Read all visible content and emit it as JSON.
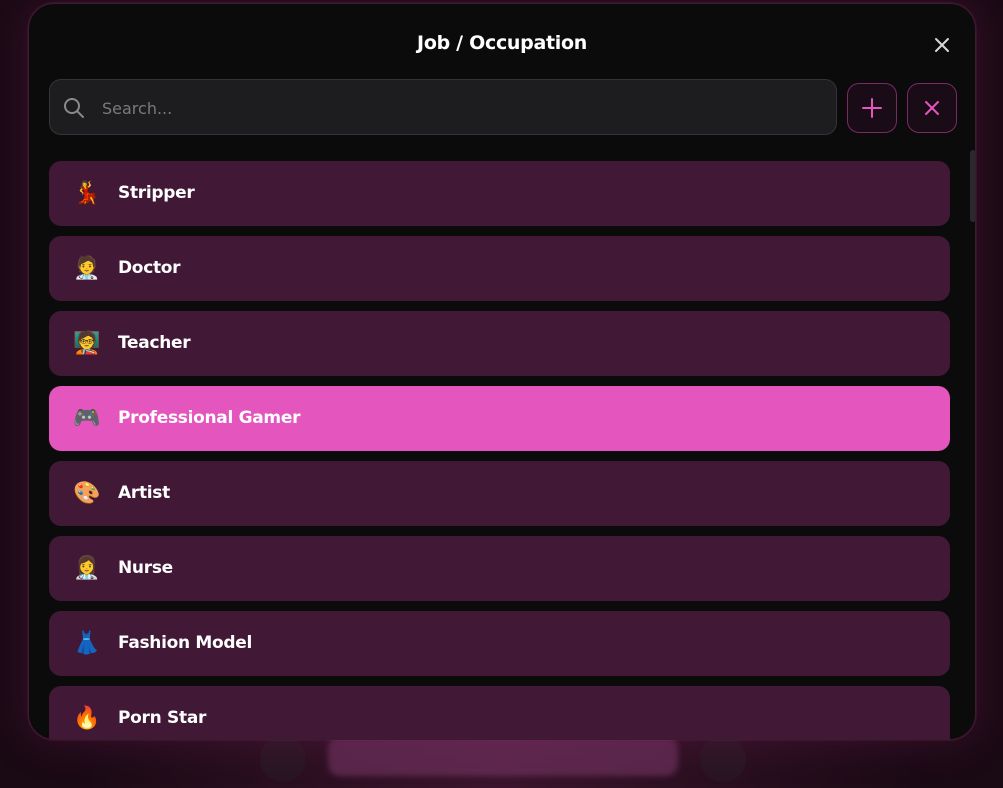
{
  "modal": {
    "title": "Job / Occupation",
    "search": {
      "placeholder": "Search...",
      "value": ""
    }
  },
  "colors": {
    "item_bg": "#411836",
    "item_selected_bg": "#e455bd",
    "button_border": "#7a2a66",
    "accent_icon": "#e455bd"
  },
  "icons": {
    "close": "close-icon",
    "search": "search-icon",
    "add": "plus-icon",
    "clear": "close-icon"
  },
  "items": [
    {
      "label": "Stripper",
      "emoji": "💃",
      "icon": "dancer-icon",
      "selected": false
    },
    {
      "label": "Doctor",
      "emoji": "🧑‍⚕️",
      "icon": "doctor-icon",
      "selected": false
    },
    {
      "label": "Teacher",
      "emoji": "🧑‍🏫",
      "icon": "teacher-icon",
      "selected": false
    },
    {
      "label": "Professional Gamer",
      "emoji": "🎮",
      "icon": "game-controller-icon",
      "selected": true
    },
    {
      "label": "Artist",
      "emoji": "🎨",
      "icon": "palette-icon",
      "selected": false
    },
    {
      "label": "Nurse",
      "emoji": "👩‍⚕️",
      "icon": "nurse-icon",
      "selected": false
    },
    {
      "label": "Fashion Model",
      "emoji": "👗",
      "icon": "dress-icon",
      "selected": false
    },
    {
      "label": "Porn Star",
      "emoji": "🔥",
      "icon": "fire-icon",
      "selected": false
    }
  ]
}
